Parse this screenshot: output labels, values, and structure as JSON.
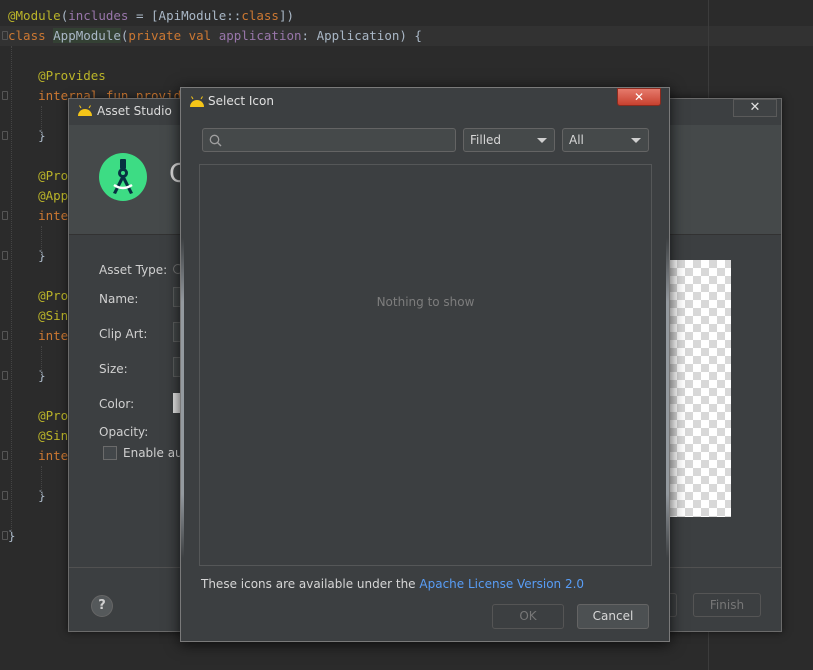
{
  "editor": {
    "lines": [
      {
        "id": "l1",
        "parts": [
          [
            "ann",
            "@Module"
          ],
          [
            "brk",
            "("
          ],
          [
            "param",
            "includes"
          ],
          [
            "brk",
            " = [ApiModule::"
          ],
          [
            "kw",
            "class"
          ],
          [
            "brk",
            "])"
          ]
        ]
      },
      {
        "id": "l2",
        "parts": [
          [
            "kw",
            "class "
          ],
          [
            "cls-hl",
            "AppModule"
          ],
          [
            "brk",
            "("
          ],
          [
            "kw",
            "private val "
          ],
          [
            "param",
            "application"
          ],
          [
            "brk",
            ": Application) {"
          ]
        ]
      },
      {
        "id": "l3",
        "parts": [
          [
            "ann",
            "    @Provides"
          ]
        ]
      },
      {
        "id": "l4",
        "parts": [
          [
            "kw",
            "    internal fun provide"
          ]
        ]
      },
      {
        "id": "l5",
        "parts": [
          [
            "brk",
            "    }"
          ]
        ]
      },
      {
        "id": "l6",
        "parts": [
          [
            "ann",
            "    @Prov"
          ]
        ]
      },
      {
        "id": "l7",
        "parts": [
          [
            "ann",
            "    @App"
          ]
        ]
      },
      {
        "id": "l8",
        "parts": [
          [
            "kw",
            "    inter"
          ]
        ]
      },
      {
        "id": "l9",
        "parts": [
          [
            "brk",
            "    }"
          ]
        ]
      },
      {
        "id": "l10",
        "parts": [
          [
            "ann",
            "    @Prov"
          ]
        ]
      },
      {
        "id": "l11",
        "parts": [
          [
            "ann",
            "    @Sing"
          ]
        ]
      },
      {
        "id": "l12",
        "parts": [
          [
            "kw",
            "    inter"
          ]
        ]
      },
      {
        "id": "l13",
        "parts": [
          [
            "brk",
            "    }"
          ]
        ]
      },
      {
        "id": "l14",
        "parts": [
          [
            "ann",
            "    @Prov"
          ]
        ]
      },
      {
        "id": "l15",
        "parts": [
          [
            "ann",
            "    @Sing"
          ]
        ]
      },
      {
        "id": "l16",
        "parts": [
          [
            "kw",
            "    inter"
          ]
        ]
      },
      {
        "id": "l17",
        "parts": [
          [
            "brk",
            "    }"
          ]
        ]
      },
      {
        "id": "l18",
        "parts": [
          [
            "brk",
            "}"
          ]
        ]
      }
    ]
  },
  "asset_studio": {
    "title": "Asset Studio",
    "close_label": "✕",
    "header_text": "C",
    "labels": {
      "asset_type": "Asset Type:",
      "name": "Name:",
      "clip_art": "Clip Art:",
      "size": "Size:",
      "color": "Color:",
      "opacity": "Opacity:",
      "enable_auto": "Enable auto"
    },
    "help_label": "?",
    "finish_label": "Finish"
  },
  "select_icon": {
    "title": "Select Icon",
    "close_label": "✕",
    "search": {
      "value": "",
      "placeholder": ""
    },
    "style_dropdown": {
      "selected": "Filled"
    },
    "category_dropdown": {
      "selected": "All"
    },
    "empty_message": "Nothing to show",
    "license_prefix": "These icons are available under the ",
    "license_link": "Apache License Version 2.0",
    "ok_label": "OK",
    "cancel_label": "Cancel"
  },
  "colors": {
    "accent_link": "#589df6",
    "android_green": "#3ddc84",
    "android_yellow": "#f5c518",
    "close_red": "#c7412f"
  }
}
